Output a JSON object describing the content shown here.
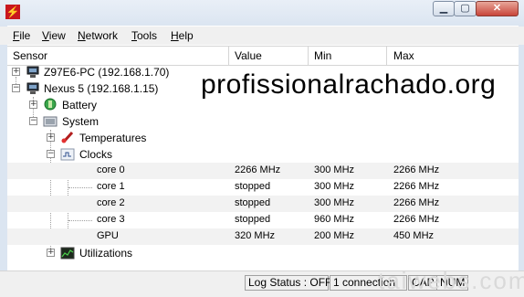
{
  "window": {
    "title": ""
  },
  "menu": [
    {
      "label": "File",
      "ul": "F",
      "rest": "ile"
    },
    {
      "label": "View",
      "ul": "V",
      "rest": "iew"
    },
    {
      "label": "Network",
      "ul": "N",
      "rest": "etwork"
    },
    {
      "label": "Tools",
      "ul": "T",
      "rest": "ools"
    },
    {
      "label": "Help",
      "ul": "H",
      "rest": "elp"
    }
  ],
  "columns": [
    "Sensor",
    "Value",
    "Min",
    "Max"
  ],
  "tree": {
    "pc": "Z97E6-PC (192.168.1.70)",
    "nexus": "Nexus 5 (192.168.1.15)",
    "battery": "Battery",
    "system": "System",
    "temperatures": "Temperatures",
    "clocks": "Clocks",
    "utilizations": "Utilizations"
  },
  "clocks": [
    {
      "name": "core 0",
      "value": "2266 MHz",
      "min": "300 MHz",
      "max": "2266 MHz"
    },
    {
      "name": "core 1",
      "value": "stopped",
      "min": "300 MHz",
      "max": "2266 MHz"
    },
    {
      "name": "core 2",
      "value": "stopped",
      "min": "300 MHz",
      "max": "2266 MHz"
    },
    {
      "name": "core 3",
      "value": "stopped",
      "min": "960 MHz",
      "max": "2266 MHz"
    },
    {
      "name": "GPU",
      "value": "320 MHz",
      "min": "200 MHz",
      "max": "450 MHz"
    }
  ],
  "watermark": "profissionalrachado.org",
  "watermark2": "taiwebs.com",
  "status": {
    "log": "Log Status : OFF",
    "connections": "1 connection",
    "cap": "CAP",
    "num": "NUM"
  },
  "icons": {
    "app": "hwmonitor-app-icon",
    "computer": "computer-icon",
    "phone": "phone-icon",
    "battery": "battery-icon",
    "system": "system-icon",
    "thermometer": "thermometer-icon",
    "clock": "clock-icon",
    "utilization": "utilization-icon"
  }
}
